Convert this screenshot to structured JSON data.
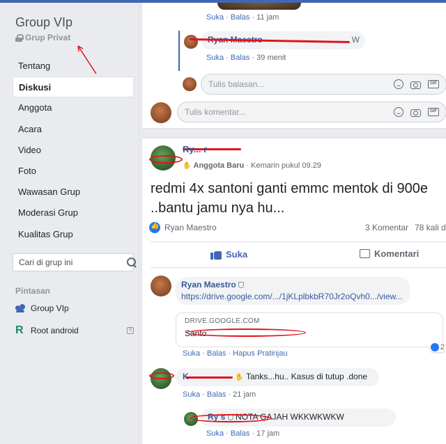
{
  "sidebar": {
    "title": "Group VIp",
    "privacy": "Grup Privat",
    "nav": [
      "Tentang",
      "Diskusi",
      "Anggota",
      "Acara",
      "Video",
      "Foto",
      "Wawasan Grup",
      "Moderasi Grup",
      "Kualitas Grup"
    ],
    "active_nav": "Diskusi",
    "search_placeholder": "Cari di grup ini",
    "shortcuts_heading": "Pintasan",
    "shortcuts": [
      {
        "label": "Group VIp",
        "icon": "group-icon"
      },
      {
        "label": "Root android",
        "icon": "r-logo-icon",
        "badge": "9"
      }
    ]
  },
  "top_card": {
    "c1_actions": {
      "like": "Suka",
      "reply": "Balas",
      "time": "11 jam"
    },
    "reply": {
      "name": "Ryan Maestro",
      "text": "W"
    },
    "reply_actions": {
      "like": "Suka",
      "reply": "Balas",
      "time": "39 menit"
    },
    "reply_placeholder": "Tulis balasan...",
    "comment_placeholder": "Tulis komentar..."
  },
  "post": {
    "author": "Ry... r",
    "badge": "Anggota Baru",
    "time": "Kemarin pukul 09.29",
    "text": "redmi 4x santoni ganti emmc mentok di 900e ..bantu jamu nya hu...",
    "liked_by": "Ryan Maestro",
    "comments_count": "3 Komentar",
    "shares": "78 kali d",
    "like_label": "Suka",
    "comment_label": "Komentari"
  },
  "comments": [
    {
      "name": "Ryan Maestro",
      "link": "https://drive.google.com/.../1jKLplbkbR70Jr2oQvh0.../view...",
      "preview_domain": "DRIVE.GOOGLE.COM",
      "preview_title": "Santo",
      "reactions": "2",
      "actions": {
        "like": "Suka",
        "reply": "Balas",
        "extra": "Hapus Pratinjau"
      }
    },
    {
      "name": "K",
      "text": "Tanks...hu.. Kasus di tutup .done",
      "actions": {
        "like": "Suka",
        "reply": "Balas",
        "time": "21 jam"
      }
    },
    {
      "name": "Ry s",
      "text": "NOTA GAJAH WKKWKWKW",
      "actions": {
        "like": "Suka",
        "reply": "Balas",
        "time": "17 jam"
      }
    }
  ],
  "colors": {
    "brand": "#4267b2",
    "link": "#385898",
    "redaction": "#e0141e",
    "bg": "#e9ebee"
  }
}
